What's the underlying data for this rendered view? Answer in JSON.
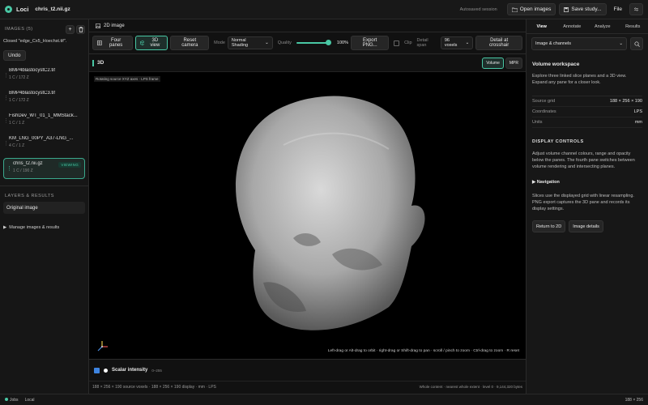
{
  "topbar": {
    "app_name": "Loci",
    "file_name": "chris_t2.nii.gz",
    "session_status": "Autosaved session",
    "open_images_label": "Open images",
    "save_study_label": "Save study...",
    "file_menu_label": "File"
  },
  "sidebar": {
    "images_header": "IMAGES (5)",
    "closed_message": "Closed \"edge_Cx5_Hoechst.tif\".",
    "undo_label": "Undo",
    "images": [
      {
        "name": "BMP4blastocystC2.tif",
        "meta": "1 C / 172 Z"
      },
      {
        "name": "BMP4blastocystC3.tif",
        "meta": "1 C / 172 Z"
      },
      {
        "name": "FishDev_WT_01_1_MMStack...",
        "meta": "1 C / 1 Z"
      },
      {
        "name": "KM_LNG_00PY_A37-LNG_...",
        "meta": "4 C / 1 Z"
      }
    ],
    "selected_image": {
      "name": "chris_t2.nii.gz",
      "meta": "1 C / 190 Z",
      "badge": "VIEWING"
    },
    "layers_header": "LAYERS & RESULTS",
    "layer_item": "Original image",
    "manage_label": "Manage images & results"
  },
  "center": {
    "tab_label": "2D image",
    "toolbar": {
      "four_panes": "Four panes",
      "view_3d": "3D view",
      "reset_camera": "Reset camera",
      "mode_label": "Mode",
      "mode_value": "Normal Shading",
      "quality_label": "Quality",
      "quality_value": "100%",
      "export_png": "Export PNG...",
      "clip_label": "Clip",
      "detail_span_label": "Detail span",
      "detail_span_value": "96 voxels",
      "detail_at_crosshair": "Detail at crosshair"
    },
    "pane_title": "3D",
    "seg_volume": "Volume",
    "seg_mpr": "MPR",
    "viewport_caption": "Rotating source XYZ axes · LPS frame",
    "viewport_hint": "Left-drag or Alt-drag to orbit · right-drag or Shift-drag to pan · scroll / pinch to zoom · Ctrl-drag to zoom · R reset",
    "legend_name": "Scalar intensity",
    "legend_range": "0–255",
    "footer_left": "188 × 256 × 190 source voxels · 188 × 256 × 190 display · mm · LPS",
    "footer_right": "Whole content · nearest whole extent · level 0 · 9,144,320 bytes"
  },
  "right": {
    "tabs": [
      "View",
      "Annotate",
      "Analyze",
      "Results"
    ],
    "dropdown_value": "Image & channels",
    "workspace_title": "Volume workspace",
    "workspace_desc": "Explore three linked slice planes and a 3D view. Expand any pane for a closer look.",
    "props": [
      {
        "k": "Source grid",
        "v": "188 × 256 × 190"
      },
      {
        "k": "Coordinates",
        "v": "LPS"
      },
      {
        "k": "Units",
        "v": "mm"
      }
    ],
    "display_controls_title": "DISPLAY CONTROLS",
    "display_controls_desc": "Adjust volume channel colours, range and opacity below the panes. The fourth pane switches between volume rendering and intersecting planes.",
    "navigation_label": "Navigation",
    "resample_note": "Slices use the displayed grid with linear resampling. PNG export captures the 3D pane and records its display settings.",
    "return_2d": "Return to 2D",
    "image_details": "Image details"
  },
  "statusbar": {
    "jobs": "Jobs",
    "location": "Local",
    "dims": "188 × 256"
  },
  "colors": {
    "accent": "#49c7a4",
    "legend_check": "#3e84e0"
  }
}
